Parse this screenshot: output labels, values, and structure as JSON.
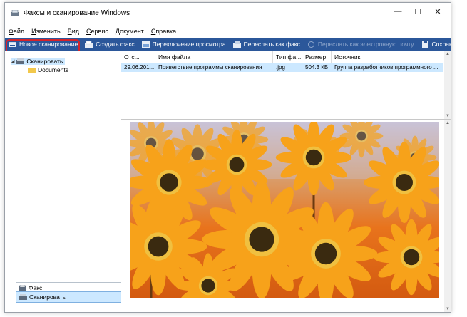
{
  "window": {
    "title": "Факсы и сканирование Windows",
    "controls": {
      "minimize": "—",
      "maximize": "☐",
      "close": "✕"
    }
  },
  "menu": [
    {
      "first": "Ф",
      "rest": "айл"
    },
    {
      "first": "И",
      "rest": "зменить"
    },
    {
      "first": "В",
      "rest": "ид"
    },
    {
      "first": "С",
      "rest": "ервис"
    },
    {
      "first": "Д",
      "rest": "окумент"
    },
    {
      "first": "С",
      "rest": "правка"
    }
  ],
  "toolbar": {
    "new_scan": "Новое сканирование",
    "create_fax": "Создать факс",
    "toggle_view": "Переключение просмотра",
    "forward_fax": "Переслать как факс",
    "forward_email": "Переслать как электронную почту",
    "save_as": "Сохранить как..."
  },
  "tree": {
    "root": "Сканировать",
    "child": "Documents"
  },
  "nav": {
    "fax": "Факс",
    "scan": "Сканировать"
  },
  "list": {
    "columns": [
      "Отс...",
      "Имя файла",
      "Тип фа...",
      "Размер",
      "Источник"
    ],
    "rows": [
      [
        "29.06.201...",
        "Приветствие программы сканирования",
        ".jpg",
        "504.3 КБ",
        "Группа разработчиков программного ..."
      ]
    ]
  },
  "colors": {
    "toolbar": "#2b579a",
    "selection": "#cce8ff",
    "highlight": "#d6232a",
    "petal": "#f7a21a",
    "background_orange": "#e8731c"
  },
  "preview": {
    "image": "orange-daisies-photo"
  }
}
